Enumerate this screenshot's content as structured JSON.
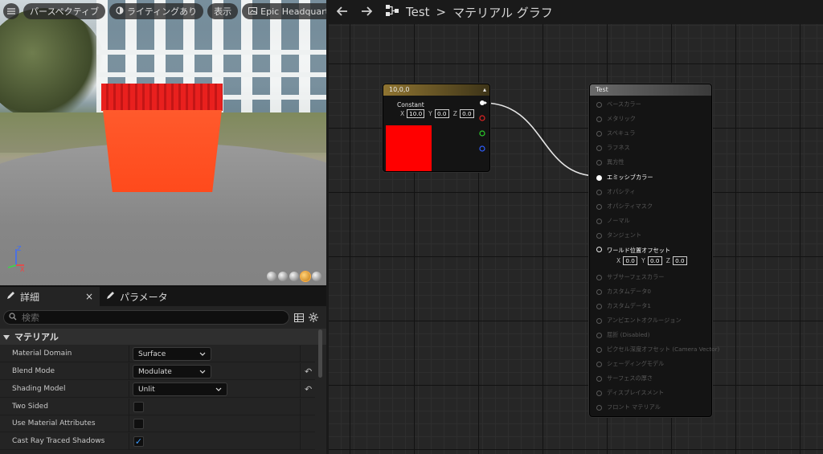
{
  "colors": {
    "accent": "#3b9bff",
    "constant_color": "#ff0000",
    "node_header_constant": "#8f7431",
    "node_header_result": "#6a6a6a"
  },
  "viewport": {
    "buttons": {
      "menu_icon": "hamburger-icon",
      "perspective": "パースペクティブ",
      "lighting": "ライティングあり",
      "show": "表示",
      "location": "Epic Headquarters"
    },
    "axes": {
      "x": "X",
      "z": "Z"
    }
  },
  "details": {
    "tabs": [
      {
        "label": "詳細",
        "icon": "pencil-icon",
        "close": "×"
      },
      {
        "label": "パラメータ",
        "icon": "pencil-icon"
      }
    ],
    "search_placeholder": "検索",
    "section_title": "マテリアル",
    "properties": [
      {
        "name": "Material Domain",
        "type": "combo",
        "value": "Surface",
        "reset": false
      },
      {
        "name": "Blend Mode",
        "type": "combo",
        "value": "Modulate",
        "reset": true
      },
      {
        "name": "Shading Model",
        "type": "combo",
        "value": "Unlit",
        "reset": true
      },
      {
        "name": "Two Sided",
        "type": "check",
        "checked": false,
        "reset": false
      },
      {
        "name": "Use Material Attributes",
        "type": "check",
        "checked": false,
        "reset": false
      },
      {
        "name": "Cast Ray Traced Shadows",
        "type": "check",
        "checked": true,
        "reset": false
      }
    ]
  },
  "graph": {
    "breadcrumb": {
      "root": "Test",
      "separator": ">",
      "current": "マテリアル グラフ"
    },
    "constant_node": {
      "title": "10,0,0",
      "label": "Constant",
      "x": "10.0",
      "y": "0.0",
      "z": "0.0"
    },
    "result_node": {
      "title": "Test",
      "pins": [
        "ベースカラー",
        "メタリック",
        "スペキュラ",
        "ラフネス",
        "異方性",
        "エミッシブカラー",
        "オパシティ",
        "オパシティマスク",
        "ノーマル",
        "タンジェント",
        "ワールド位置オフセット",
        "サブサーフェスカラー",
        "カスタムデータ0",
        "カスタムデータ1",
        "アンビエントオクルージョン",
        "屈折 (Disabled)",
        "ピクセル深度オフセット (Camera Vector)",
        "シェーディングモデル",
        "サーフェスの厚さ",
        "ディスプレイスメント",
        "フロント マテリアル"
      ],
      "active_pin": "エミッシブカラー",
      "wpo_values": {
        "x": "0.0",
        "y": "0.0",
        "z": "0.0"
      }
    }
  }
}
